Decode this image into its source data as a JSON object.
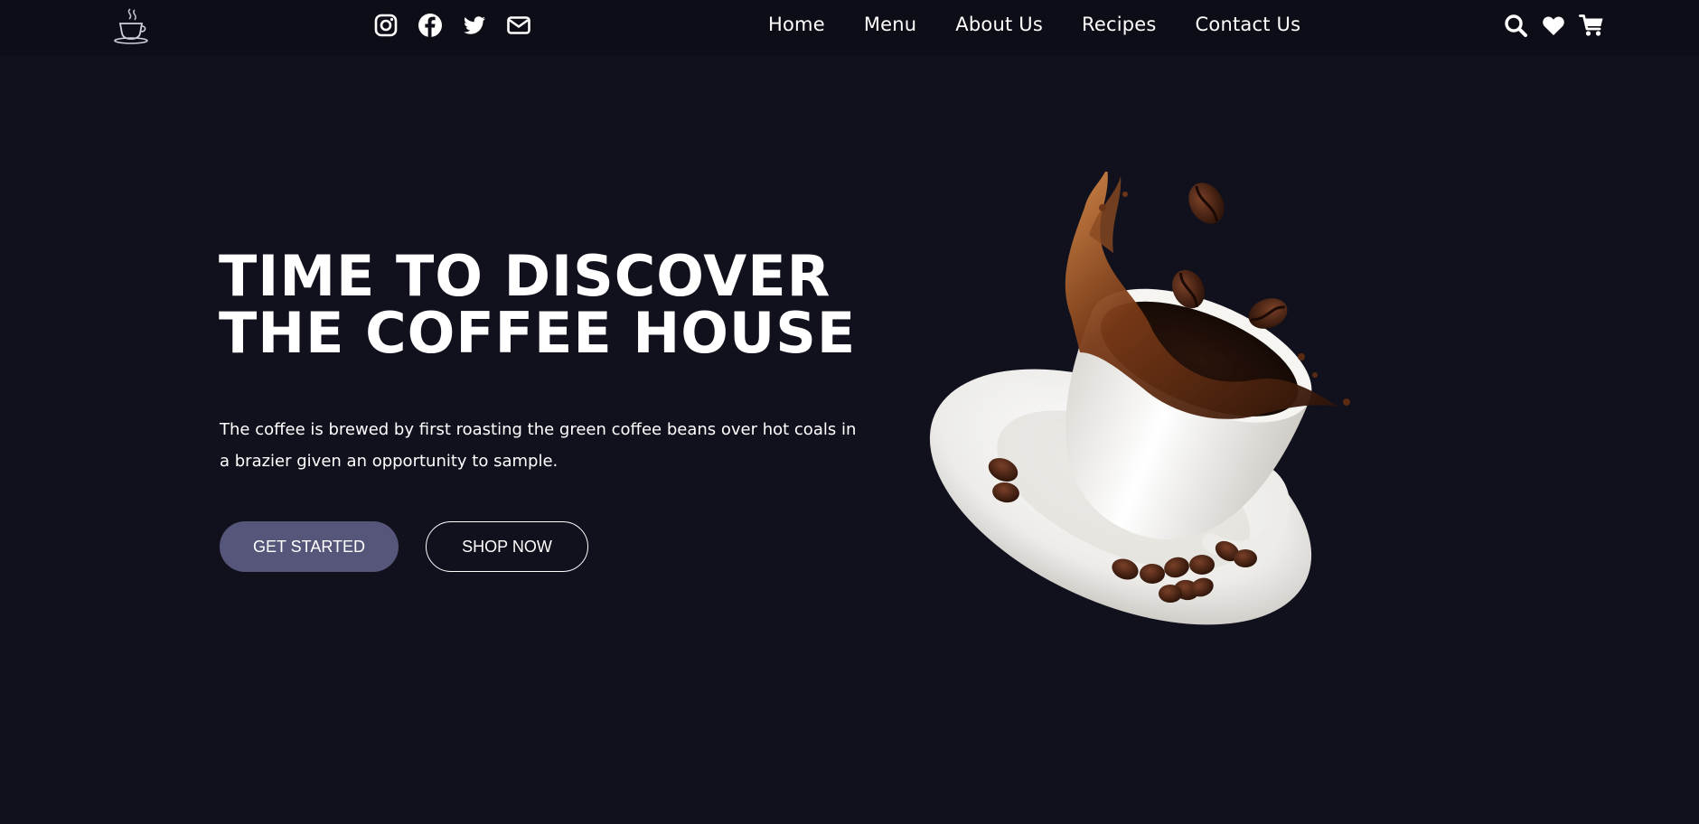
{
  "navbar": {
    "logo_icon": "coffee-cup-logo-icon",
    "social_icons": [
      "instagram-icon",
      "facebook-icon",
      "twitter-icon",
      "envelope-icon"
    ],
    "links": [
      "Home",
      "Menu",
      "About Us",
      "Recipes",
      "Contact Us"
    ],
    "action_icons": [
      "search-icon",
      "heart-icon",
      "cart-icon"
    ]
  },
  "hero": {
    "title_line1": "TIME TO DISCOVER",
    "title_line2": "THE COFFEE HOUSE",
    "description": "The coffee is brewed by first roasting the green coffee beans over hot coals in a brazier given an opportunity to sample.",
    "primary_button": "GET STARTED",
    "secondary_button": "SHOP NOW",
    "image_icon": "coffee-cup-splash-image"
  },
  "colors": {
    "background": "#11111d",
    "navbar": "#0d0d17",
    "primary_button": "#56557a",
    "text": "#ffffff",
    "coffee": "#3a1c10"
  }
}
